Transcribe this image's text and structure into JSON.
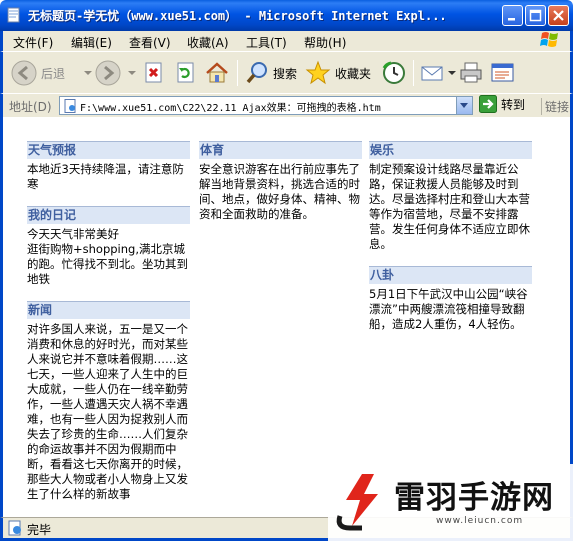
{
  "window": {
    "title": "无标题页-学无忧（www.xue51.com） - Microsoft Internet Expl..."
  },
  "menu": [
    "文件(F)",
    "编辑(E)",
    "查看(V)",
    "收藏(A)",
    "工具(T)",
    "帮助(H)"
  ],
  "toolbar": {
    "back_label": "后退",
    "search_label": "搜索",
    "favorites_label": "收藏夹"
  },
  "address": {
    "label": "地址(D)",
    "value": "F:\\www.xue51.com\\C22\\22.11  Ajax效果：可拖拽的表格.htm",
    "go_label": "转到",
    "links_label": "链接"
  },
  "columns": [
    [
      {
        "title": "天气预报",
        "body": "本地近3天持续降温，请注意防寒"
      },
      {
        "title": "我的日记",
        "body": "今天天气非常美好\n逛街购物+shopping,满北京城的跑。忙得找不到北。坐功其到地铁"
      },
      {
        "title": "新闻",
        "body": "对许多国人来说，五一是又一个消费和休息的好时光，而对某些人来说它并不意味着假期……这七天，一些人迎来了人生中的巨大成就，一些人仍在一线辛勤劳作，一些人遭遇天灾人祸不幸遇难，也有一些人因为捉救别人而失去了珍贵的生命……人们复杂的命运故事并不因为假期而中断，看看这七天你离开的时候，那些大人物或者小人物身上又发生了什么样的新故事"
      }
    ],
    [
      {
        "title": "体育",
        "body": "安全意识游客在出行前应事先了解当地背景资料，挑选合适的时间、地点，做好身体、精神、物资和全面救助的准备。"
      }
    ],
    [
      {
        "title": "娱乐",
        "body": "制定预案设计线路尽量靠近公路，保证救援人员能够及时到达。尽量选择村庄和登山大本营等作为宿营地，尽量不安排露营。发生任何身体不适应立即休息。"
      },
      {
        "title": "八卦",
        "body": "5月1日下午武汉中山公园“峡谷漂流”中两艘漂流筏相撞导致翻船，造成2人重伤，4人轻伤。"
      }
    ]
  ],
  "status": {
    "text": "完毕"
  },
  "watermark": {
    "text": "雷羽手游网",
    "url": "www.leiucn.com"
  },
  "colors": {
    "titlebar": "#0054e3",
    "chrome": "#ece9d8",
    "header_bg": "#dce6f5",
    "header_text": "#3f5f9f",
    "watermark_red": "#e0251b"
  }
}
